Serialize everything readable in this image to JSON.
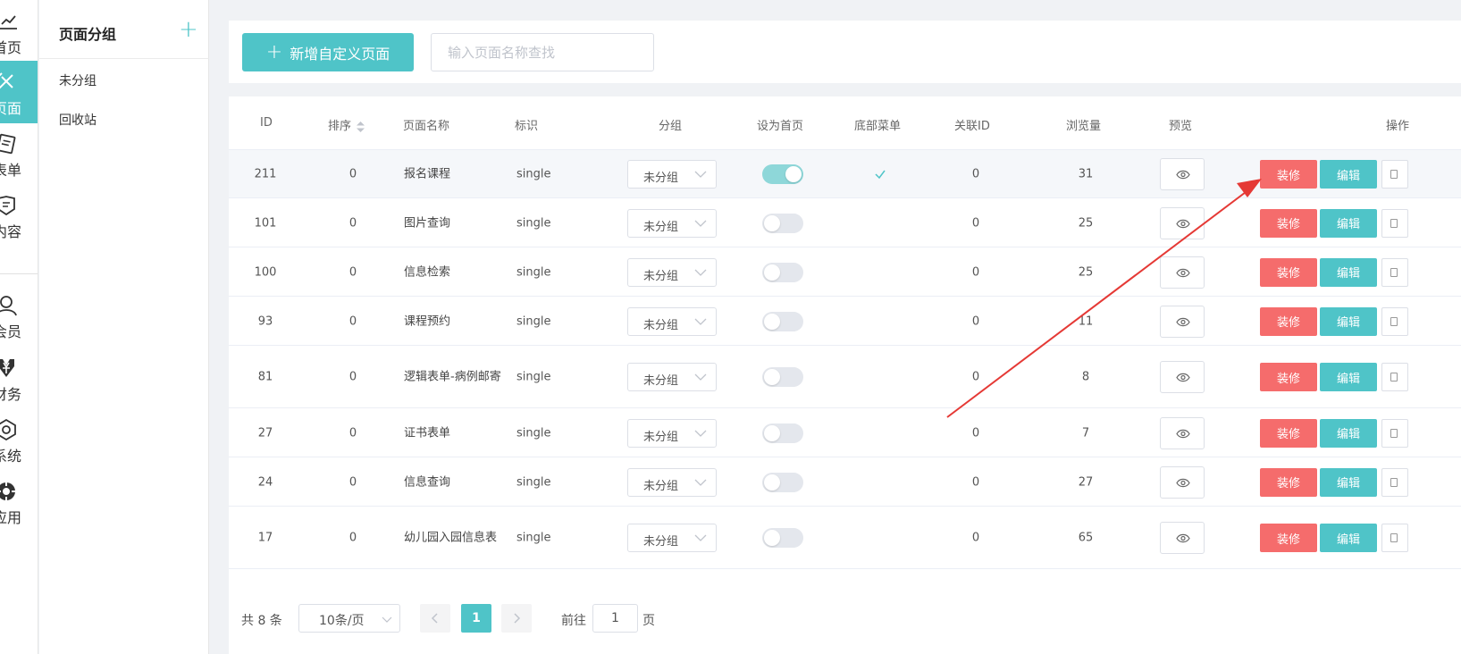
{
  "nav": {
    "items": [
      {
        "label": "首页",
        "icon": "chart-icon"
      },
      {
        "label": "页面",
        "icon": "design-icon",
        "active": true
      },
      {
        "label": "表单",
        "icon": "form-icon"
      },
      {
        "label": "内容",
        "icon": "content-icon"
      },
      {
        "label": "会员",
        "icon": "user-icon"
      },
      {
        "label": "财务",
        "icon": "yen-icon"
      },
      {
        "label": "系统",
        "icon": "settings-icon"
      },
      {
        "label": "应用",
        "icon": "app-icon"
      }
    ]
  },
  "groups": {
    "title": "页面分组",
    "add": "+",
    "items": [
      "未分组",
      "回收站"
    ]
  },
  "toolbar": {
    "new_label": "新增自定义页面",
    "search_placeholder": "输入页面名称查找"
  },
  "table": {
    "headers": {
      "id": "ID",
      "sort": "排序",
      "name": "页面名称",
      "tag": "标识",
      "group": "分组",
      "home": "设为首页",
      "bottom_menu": "底部菜单",
      "relid": "关联ID",
      "views": "浏览量",
      "preview": "预览",
      "ops": "操作"
    },
    "rows": [
      {
        "id": "211",
        "sort": "0",
        "name": "报名课程",
        "tag": "single",
        "group": "未分组",
        "home": true,
        "bottom_menu": true,
        "relid": "0",
        "views": "31",
        "deco": "装修",
        "edit": "编辑"
      },
      {
        "id": "101",
        "sort": "0",
        "name": "图片查询",
        "tag": "single",
        "group": "未分组",
        "home": false,
        "bottom_menu": false,
        "relid": "0",
        "views": "25",
        "deco": "装修",
        "edit": "编辑"
      },
      {
        "id": "100",
        "sort": "0",
        "name": "信息检索",
        "tag": "single",
        "group": "未分组",
        "home": false,
        "bottom_menu": false,
        "relid": "0",
        "views": "25",
        "deco": "装修",
        "edit": "编辑"
      },
      {
        "id": "93",
        "sort": "0",
        "name": "课程预约",
        "tag": "single",
        "group": "未分组",
        "home": false,
        "bottom_menu": false,
        "relid": "0",
        "views": "11",
        "deco": "装修",
        "edit": "编辑"
      },
      {
        "id": "81",
        "sort": "0",
        "name": "逻辑表单-病例邮寄",
        "tag": "single",
        "group": "未分组",
        "home": false,
        "bottom_menu": false,
        "relid": "0",
        "views": "8",
        "deco": "装修",
        "edit": "编辑"
      },
      {
        "id": "27",
        "sort": "0",
        "name": "证书表单",
        "tag": "single",
        "group": "未分组",
        "home": false,
        "bottom_menu": false,
        "relid": "0",
        "views": "7",
        "deco": "装修",
        "edit": "编辑"
      },
      {
        "id": "24",
        "sort": "0",
        "name": "信息查询",
        "tag": "single",
        "group": "未分组",
        "home": false,
        "bottom_menu": false,
        "relid": "0",
        "views": "27",
        "deco": "装修",
        "edit": "编辑"
      },
      {
        "id": "17",
        "sort": "0",
        "name": "幼儿园入园信息表",
        "tag": "single",
        "group": "未分组",
        "home": false,
        "bottom_menu": false,
        "relid": "0",
        "views": "65",
        "deco": "装修",
        "edit": "编辑"
      }
    ]
  },
  "pager": {
    "total": "共 8 条",
    "size": "10条/页",
    "current": "1",
    "goto": "前往",
    "goto_value": "1",
    "unit": "页"
  },
  "colors": {
    "accent": "#4fc4c8",
    "danger": "#f56c6c",
    "arrow": "#e53935"
  }
}
